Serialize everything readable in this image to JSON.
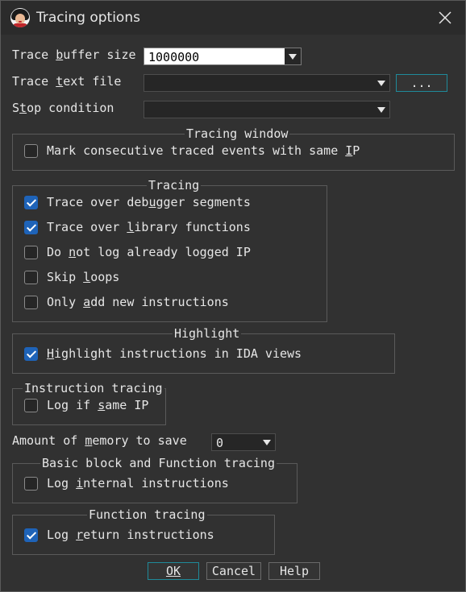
{
  "window": {
    "title": "Tracing options"
  },
  "fields": {
    "trace_buffer_size": {
      "label_pre": "Trace ",
      "label_u": "b",
      "label_post": "uffer size",
      "value": "1000000"
    },
    "trace_text_file": {
      "label_pre": "Trace ",
      "label_u": "t",
      "label_post": "ext file",
      "value": "",
      "browse_label": "..."
    },
    "stop_condition": {
      "label_pre": "S",
      "label_u": "t",
      "label_post": "op condition",
      "value": ""
    }
  },
  "tracing_window": {
    "title": "Tracing window",
    "items": [
      {
        "pre": "Mark consecutive traced events with same ",
        "u": "I",
        "post": "P",
        "checked": false
      }
    ]
  },
  "tracing": {
    "title": "Tracing",
    "items": [
      {
        "pre": "Trace over deb",
        "u": "u",
        "post": "gger segments",
        "checked": true
      },
      {
        "pre": "Trace over ",
        "u": "l",
        "post": "ibrary functions",
        "checked": true
      },
      {
        "pre": "Do ",
        "u": "n",
        "post": "ot log already logged IP",
        "checked": false
      },
      {
        "pre": "Skip ",
        "u": "l",
        "post": "oops",
        "checked": false
      },
      {
        "pre": "Only ",
        "u": "a",
        "post": "dd new instructions",
        "checked": false
      }
    ]
  },
  "highlight": {
    "title": "Highlight",
    "items": [
      {
        "pre": "",
        "u": "H",
        "post": "ighlight instructions in IDA views",
        "checked": true
      }
    ]
  },
  "instruction_tracing": {
    "title": "Instruction tracing",
    "items": [
      {
        "pre": "Log if ",
        "u": "s",
        "post": "ame IP",
        "checked": false
      }
    ]
  },
  "memory": {
    "label_pre": "Amount of ",
    "label_u": "m",
    "label_post": "emory to save",
    "value": "0"
  },
  "basic_block": {
    "title": "Basic block and Function tracing",
    "items": [
      {
        "pre": "Log ",
        "u": "i",
        "post": "nternal instructions",
        "checked": false
      }
    ]
  },
  "function_tracing": {
    "title": "Function tracing",
    "items": [
      {
        "pre": "Log ",
        "u": "r",
        "post": "eturn instructions",
        "checked": true
      }
    ]
  },
  "buttons": {
    "ok": "OK",
    "cancel": "Cancel",
    "help": "Help"
  },
  "colors": {
    "accent": "#1e63b8",
    "dialog_bg": "#313131",
    "focus_border": "#1f8a9a"
  }
}
